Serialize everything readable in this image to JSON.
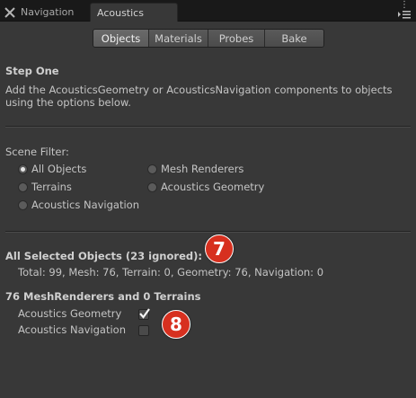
{
  "tabs": {
    "navigation_label": "Navigation",
    "acoustics_label": "Acoustics"
  },
  "toolbar": {
    "buttons": [
      "Objects",
      "Materials",
      "Probes",
      "Bake"
    ],
    "active": "Objects"
  },
  "step": {
    "title": "Step One",
    "description_line1": "Add the AcousticsGeometry or AcousticsNavigation components to objects",
    "description_line2": "using the options below."
  },
  "filter": {
    "label": "Scene Filter:",
    "options": [
      "All Objects",
      "Mesh Renderers",
      "Terrains",
      "Acoustics Geometry",
      "Acoustics Navigation"
    ],
    "selected": "All Objects"
  },
  "selected": {
    "title": "All Selected Objects (23 ignored):",
    "summary": "Total: 99, Mesh: 76, Terrain: 0, Geometry: 76, Navigation: 0"
  },
  "mesh": {
    "title": "76 MeshRenderers and 0 Terrains",
    "geometry_label": "Acoustics Geometry",
    "geometry_checked": true,
    "navigation_label": "Acoustics Navigation",
    "navigation_checked": false
  },
  "badges": {
    "first": "7",
    "second": "8",
    "color": "#d7301f"
  }
}
